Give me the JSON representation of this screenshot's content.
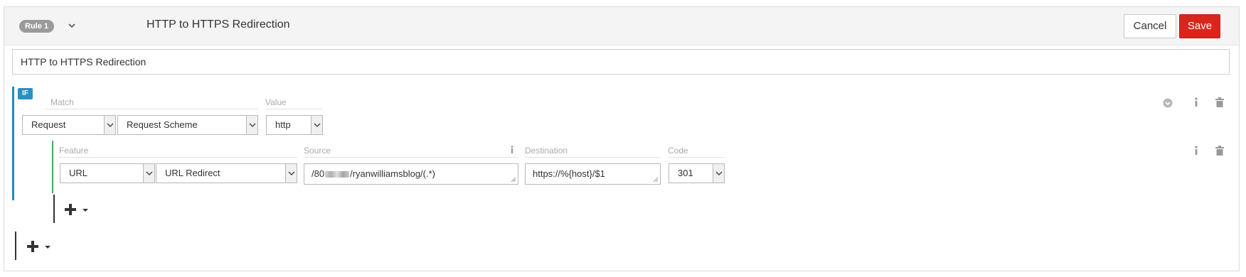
{
  "header": {
    "rule_badge": "Rule 1",
    "title": "HTTP to HTTPS Redirection",
    "cancel_label": "Cancel",
    "save_label": "Save",
    "save_color": "#d9261c"
  },
  "rule_name_value": "HTTP to HTTPS Redirection",
  "condition": {
    "badge": "IF",
    "match_label": "Match",
    "value_label": "Value",
    "match_type": "Request",
    "match_field": "Request Scheme",
    "value": "http",
    "accent_color": "#1f8ac0",
    "icons": [
      "chevron-circle-icon",
      "info-icon",
      "trash-icon"
    ]
  },
  "feature": {
    "feature_label": "Feature",
    "source_label": "Source",
    "destination_label": "Destination",
    "code_label": "Code",
    "feature_type": "URL",
    "feature_action": "URL Redirect",
    "source_prefix": "/80",
    "source_suffix": "/ryanwilliamsblog/(.*)",
    "destination": "https://%{host}/$1",
    "code": "301",
    "accent_color": "#3cae5a",
    "icons": [
      "info-icon",
      "trash-icon"
    ]
  },
  "add_controls": [
    "add-feature-button",
    "add-condition-button"
  ]
}
